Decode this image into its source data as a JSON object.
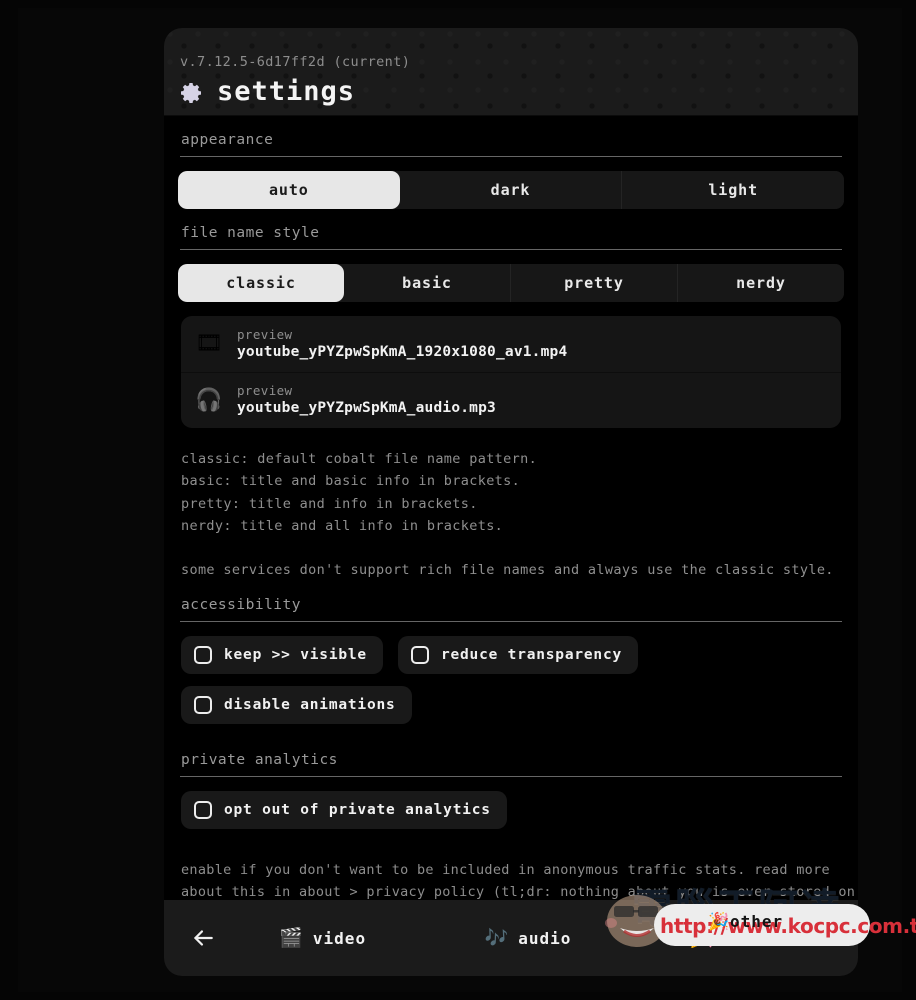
{
  "header": {
    "version": "v.7.12.5-6d17ff2d (current)",
    "title": "settings",
    "gear_icon": "gear-icon"
  },
  "appearance": {
    "label": "appearance",
    "options": [
      "auto",
      "dark",
      "light"
    ],
    "selected": "auto"
  },
  "file_name_style": {
    "label": "file name style",
    "options": [
      "classic",
      "basic",
      "pretty",
      "nerdy"
    ],
    "selected": "classic",
    "previews": [
      {
        "icon": "film-frames-icon",
        "emoji": "🎞",
        "caption": "preview",
        "filename": "youtube_yPYZpwSpKmA_1920x1080_av1.mp4"
      },
      {
        "icon": "headphones-icon",
        "emoji": "🎧",
        "caption": "preview",
        "filename": "youtube_yPYZpwSpKmA_audio.mp3"
      }
    ],
    "descriptions": [
      "classic: default cobalt file name pattern.",
      "basic: title and basic info in brackets.",
      "pretty: title and info in brackets.",
      "nerdy: title and all info in brackets."
    ],
    "footnote": "some services don't support rich file names and always use the classic style."
  },
  "accessibility": {
    "label": "accessibility",
    "rows": [
      [
        {
          "label": "keep >> visible",
          "checked": false
        },
        {
          "label": "reduce transparency",
          "checked": false
        }
      ],
      [
        {
          "label": "disable animations",
          "checked": false
        }
      ]
    ]
  },
  "private_analytics": {
    "label": "private analytics",
    "toggle": {
      "label": "opt out of private analytics",
      "checked": false
    },
    "notes": [
      "enable if you don't want to be included in anonymous traffic stats. read more",
      "about this in about > privacy policy (tl;dr: nothing about you is ever stored on"
    ]
  },
  "footer": {
    "back_icon": "back-arrow-icon",
    "tabs": [
      {
        "label": "video",
        "icon": "clapper-board-icon",
        "emoji": "🎬"
      },
      {
        "label": "audio",
        "icon": "musical-notes-icon",
        "emoji": "🎶"
      },
      {
        "label": "other",
        "icon": "party-popper-icon",
        "emoji": "🎉"
      }
    ]
  },
  "watermark": {
    "cjk_text": "電腦王阿達",
    "url": "http://www.kocpc.com.tw"
  },
  "colors": {
    "page_background": "#000000",
    "card_background": "#000000",
    "card_header": "#1b1b1b",
    "selected_segment": "#e7e7e7",
    "unselected_segment": "#171717",
    "pill_background": "#191919",
    "muted_text": "#8f8f8f",
    "primary_text": "#f2f2f2",
    "accent_purple": "#9b6fd4",
    "watermark_red": "#d8303a"
  }
}
